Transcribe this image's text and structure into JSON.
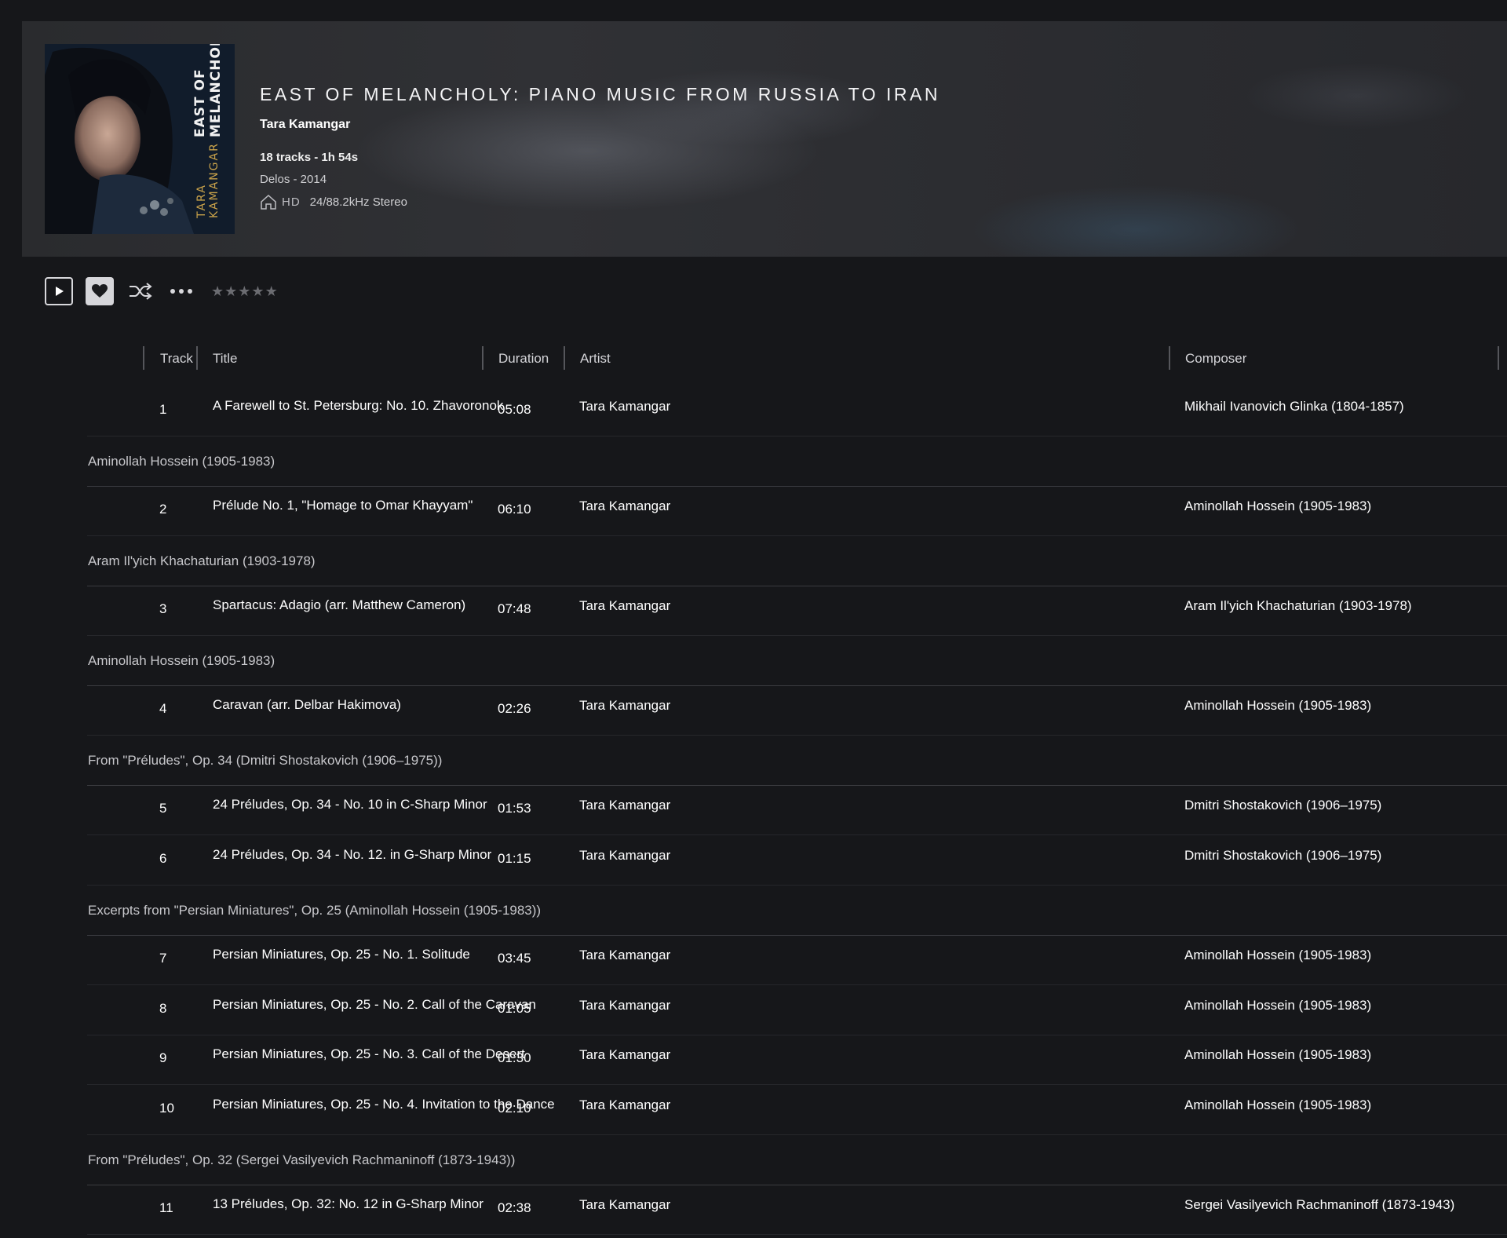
{
  "album": {
    "title": "EAST OF MELANCHOLY: PIANO MUSIC FROM RUSSIA TO IRAN",
    "artist": "Tara Kamangar",
    "meta": "18 tracks - 1h 54s",
    "label": "Delos - 2014",
    "hd": "HD",
    "quality": "24/88.2kHz Stereo",
    "cover_artist": "TARA KAMANGAR",
    "cover_title": "EAST OF MELANCHOLY"
  },
  "toolbar": {
    "play_icon": "play-icon",
    "favorite_icon": "heart-icon",
    "shuffle_icon": "shuffle-icon",
    "more_icon": "more-icon",
    "rating_stars": 0,
    "rating_max": 5,
    "star_glyph": "★"
  },
  "columns": {
    "track": "Track",
    "title": "Title",
    "duration": "Duration",
    "artist": "Artist",
    "composer": "Composer"
  },
  "rows": [
    {
      "kind": "track",
      "num": "1",
      "title": "A Farewell to St. Petersburg: No. 10. Zhavoronok",
      "duration": "05:08",
      "artist": "Tara Kamangar",
      "composer": "Mikhail Ivanovich Glinka (1804-1857)"
    },
    {
      "kind": "group",
      "label": "Aminollah Hossein (1905-1983)"
    },
    {
      "kind": "track",
      "num": "2",
      "title": "Prélude No. 1, \"Homage to Omar Khayyam\"",
      "duration": "06:10",
      "artist": "Tara Kamangar",
      "composer": "Aminollah Hossein (1905-1983)"
    },
    {
      "kind": "group",
      "label": "Aram Il'yich Khachaturian (1903-1978)"
    },
    {
      "kind": "track",
      "num": "3",
      "title": "Spartacus: Adagio (arr. Matthew Cameron)",
      "duration": "07:48",
      "artist": "Tara Kamangar",
      "composer": "Aram Il'yich Khachaturian (1903-1978)"
    },
    {
      "kind": "group",
      "label": "Aminollah Hossein (1905-1983)"
    },
    {
      "kind": "track",
      "num": "4",
      "title": "Caravan (arr. Delbar Hakimova)",
      "duration": "02:26",
      "artist": "Tara Kamangar",
      "composer": "Aminollah Hossein (1905-1983)"
    },
    {
      "kind": "group",
      "label": "From \"Préludes\", Op. 34 (Dmitri Shostakovich (1906–1975))"
    },
    {
      "kind": "track",
      "num": "5",
      "title": "24 Préludes, Op. 34 - No. 10 in C-Sharp Minor",
      "duration": "01:53",
      "artist": "Tara Kamangar",
      "composer": "Dmitri Shostakovich (1906–1975)"
    },
    {
      "kind": "track",
      "num": "6",
      "title": "24 Préludes, Op. 34 - No. 12. in G-Sharp Minor",
      "duration": "01:15",
      "artist": "Tara Kamangar",
      "composer": "Dmitri Shostakovich (1906–1975)"
    },
    {
      "kind": "group",
      "label": "Excerpts from \"Persian Miniatures\", Op. 25 (Aminollah Hossein (1905-1983))"
    },
    {
      "kind": "track",
      "num": "7",
      "title": "Persian Miniatures, Op. 25 - No. 1. Solitude",
      "duration": "03:45",
      "artist": "Tara Kamangar",
      "composer": "Aminollah Hossein (1905-1983)"
    },
    {
      "kind": "track",
      "num": "8",
      "title": "Persian Miniatures, Op. 25 - No. 2. Call of the Caravan",
      "duration": "01:05",
      "artist": "Tara Kamangar",
      "composer": "Aminollah Hossein (1905-1983)"
    },
    {
      "kind": "track",
      "num": "9",
      "title": "Persian Miniatures, Op. 25 - No. 3. Call of the Desert",
      "duration": "01:30",
      "artist": "Tara Kamangar",
      "composer": "Aminollah Hossein (1905-1983)"
    },
    {
      "kind": "track",
      "num": "10",
      "title": "Persian Miniatures, Op. 25 - No. 4. Invitation to the Dance",
      "duration": "02:10",
      "artist": "Tara Kamangar",
      "composer": "Aminollah Hossein (1905-1983)"
    },
    {
      "kind": "group",
      "label": "From \"Préludes\", Op. 32 (Sergei Vasilyevich Rachmaninoff (1873-1943))"
    },
    {
      "kind": "track",
      "num": "11",
      "title": "13 Préludes, Op. 32: No. 12 in G-Sharp Minor",
      "duration": "02:38",
      "artist": "Tara Kamangar",
      "composer": "Sergei Vasilyevich Rachmaninoff (1873-1943)"
    }
  ],
  "colors": {
    "background": "#16171a",
    "header_bg": "#2b2c30",
    "text": "#ffffff",
    "muted": "#c7c7cb",
    "cover_gold": "#c9a24a"
  }
}
